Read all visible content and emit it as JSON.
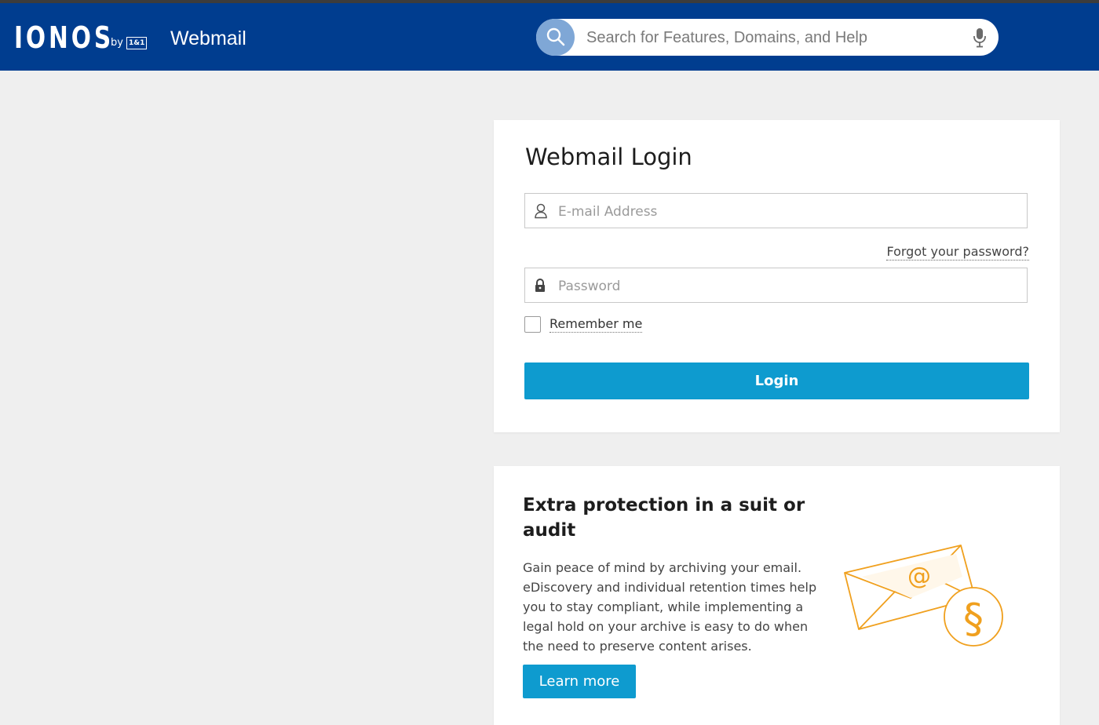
{
  "brand": {
    "logo_word": "IONOS",
    "logo_by": "by",
    "logo_badge": "1&1",
    "app_name": "Webmail"
  },
  "search": {
    "placeholder": "Search for Features, Domains, and Help"
  },
  "login": {
    "title": "Webmail Login",
    "email_placeholder": "E-mail Address",
    "forgot_label": "Forgot your password?",
    "password_placeholder": "Password",
    "remember_label": "Remember me",
    "remember_checked": false,
    "login_label": "Login"
  },
  "promo": {
    "title": "Extra protection in a suit or audit",
    "text": "Gain peace of mind by archiving your email. eDiscovery and individual retention times help you to stay compliant, while implementing a legal hold on your archive is easy to do when the need to preserve content arises.",
    "button_label": "Learn more",
    "illustration": "envelope-at-paragraph"
  },
  "colors": {
    "header_bg": "#003d8f",
    "accent": "#0e9bcf",
    "page_bg": "#efefef",
    "illustration": "#f0a01e"
  }
}
